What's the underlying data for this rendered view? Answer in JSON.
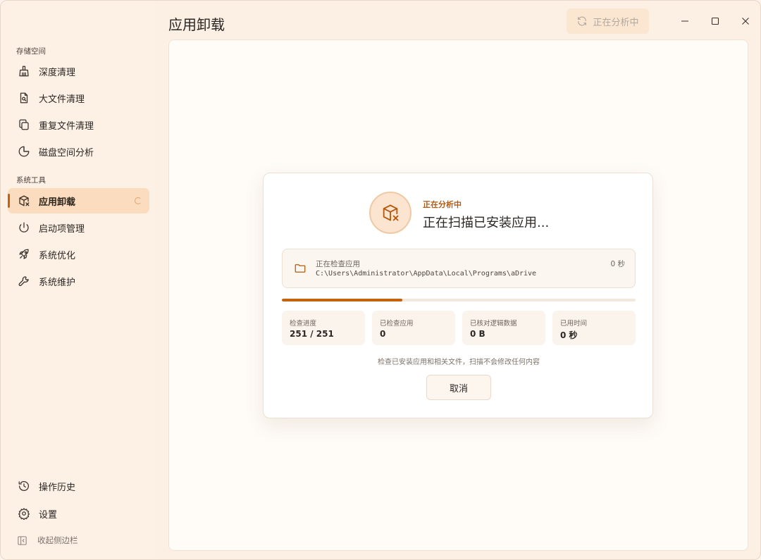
{
  "app": {
    "page_title": "应用卸载"
  },
  "header": {
    "status_button_label": "正在分析中",
    "status_icon": "refresh-icon",
    "window_controls": [
      "minimize-icon",
      "maximize-icon",
      "close-icon"
    ]
  },
  "sidebar": {
    "section_storage": "存储空间",
    "section_tools": "系统工具",
    "storage_items": [
      {
        "label": "深度清理",
        "icon": "broom-icon"
      },
      {
        "label": "大文件清理",
        "icon": "file-search-icon"
      },
      {
        "label": "重复文件清理",
        "icon": "copy-icon"
      },
      {
        "label": "磁盘空间分析",
        "icon": "pie-chart-icon"
      }
    ],
    "tool_items": [
      {
        "label": "应用卸载",
        "icon": "package-remove-icon",
        "active": true
      },
      {
        "label": "启动项管理",
        "icon": "power-icon"
      },
      {
        "label": "系统优化",
        "icon": "rocket-icon"
      },
      {
        "label": "系统维护",
        "icon": "wrench-icon"
      }
    ],
    "bottom_items": [
      {
        "label": "操作历史",
        "icon": "history-icon"
      },
      {
        "label": "设置",
        "icon": "gear-icon"
      }
    ],
    "collapse_label": "收起侧边栏"
  },
  "card": {
    "status_label": "正在分析中",
    "title": "正在扫描已安装应用...",
    "current_label": "正在检查应用",
    "current_path": "C:\\Users\\Administrator\\AppData\\Local\\Programs\\aDrive",
    "elapsed_short": "0 秒",
    "progress_fraction": 0.34,
    "stats": [
      {
        "label": "检查进度",
        "value": "251 / 251"
      },
      {
        "label": "已检查应用",
        "value": "0"
      },
      {
        "label": "已核对逻辑数据",
        "value": "0 B"
      },
      {
        "label": "已用时间",
        "value": "0 秒"
      }
    ],
    "note": "检查已安装应用和相关文件，扫描不会修改任何内容",
    "cancel_label": "取消"
  },
  "colors": {
    "accent": "#c4620d",
    "active_bg": "#fbdcbf",
    "sidebar_bg": "#fdf0e4"
  }
}
